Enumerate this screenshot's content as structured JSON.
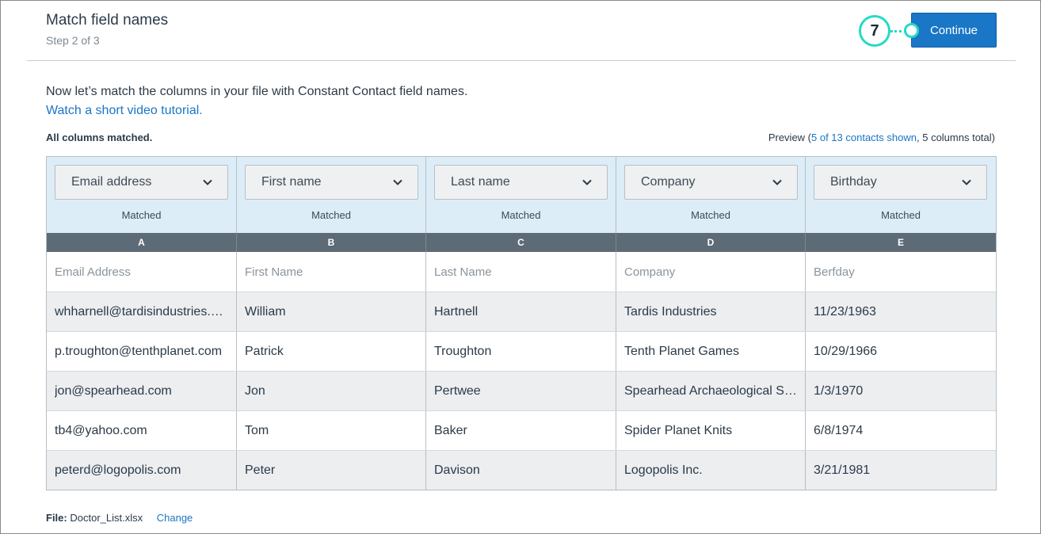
{
  "header": {
    "title": "Match field names",
    "step": "Step 2 of 3",
    "continue_label": "Continue",
    "callout_number": "7"
  },
  "intro": {
    "text": "Now let’s match the columns in your file with Constant Contact field names.",
    "video_link": "Watch a short video tutorial."
  },
  "status": {
    "matched_text": "All columns matched.",
    "preview_prefix": "Preview (",
    "preview_link": "5 of 13 contacts shown",
    "preview_suffix": ", 5 columns total)"
  },
  "columns": [
    {
      "field": "Email address",
      "status": "Matched",
      "letter": "A",
      "header": "Email Address"
    },
    {
      "field": "First name",
      "status": "Matched",
      "letter": "B",
      "header": "First Name"
    },
    {
      "field": "Last name",
      "status": "Matched",
      "letter": "C",
      "header": "Last Name"
    },
    {
      "field": "Company",
      "status": "Matched",
      "letter": "D",
      "header": "Company"
    },
    {
      "field": "Birthday",
      "status": "Matched",
      "letter": "E",
      "header": "Berfday"
    }
  ],
  "rows": [
    [
      "whharnell@tardisindustries.com",
      "William",
      "Hartnell",
      "Tardis Industries",
      "11/23/1963"
    ],
    [
      "p.troughton@tenthplanet.com",
      "Patrick",
      "Troughton",
      "Tenth Planet Games",
      "10/29/1966"
    ],
    [
      "jon@spearhead.com",
      "Jon",
      "Pertwee",
      "Spearhead Archaeological Society",
      "1/3/1970"
    ],
    [
      "tb4@yahoo.com",
      "Tom",
      "Baker",
      "Spider Planet Knits",
      "6/8/1974"
    ],
    [
      "peterd@logopolis.com",
      "Peter",
      "Davison",
      "Logopolis Inc.",
      "3/21/1981"
    ]
  ],
  "file": {
    "label": "File:",
    "name": "Doctor_List.xlsx",
    "change_label": "Change"
  },
  "icons": {
    "dropdown": "chevron-down-icon"
  },
  "colors": {
    "primary": "#1a76c6",
    "callout": "#27d9c6",
    "mapping_bg": "#dcedf7",
    "letter_bg": "#5d6b77",
    "alt_row": "#eceef0"
  }
}
